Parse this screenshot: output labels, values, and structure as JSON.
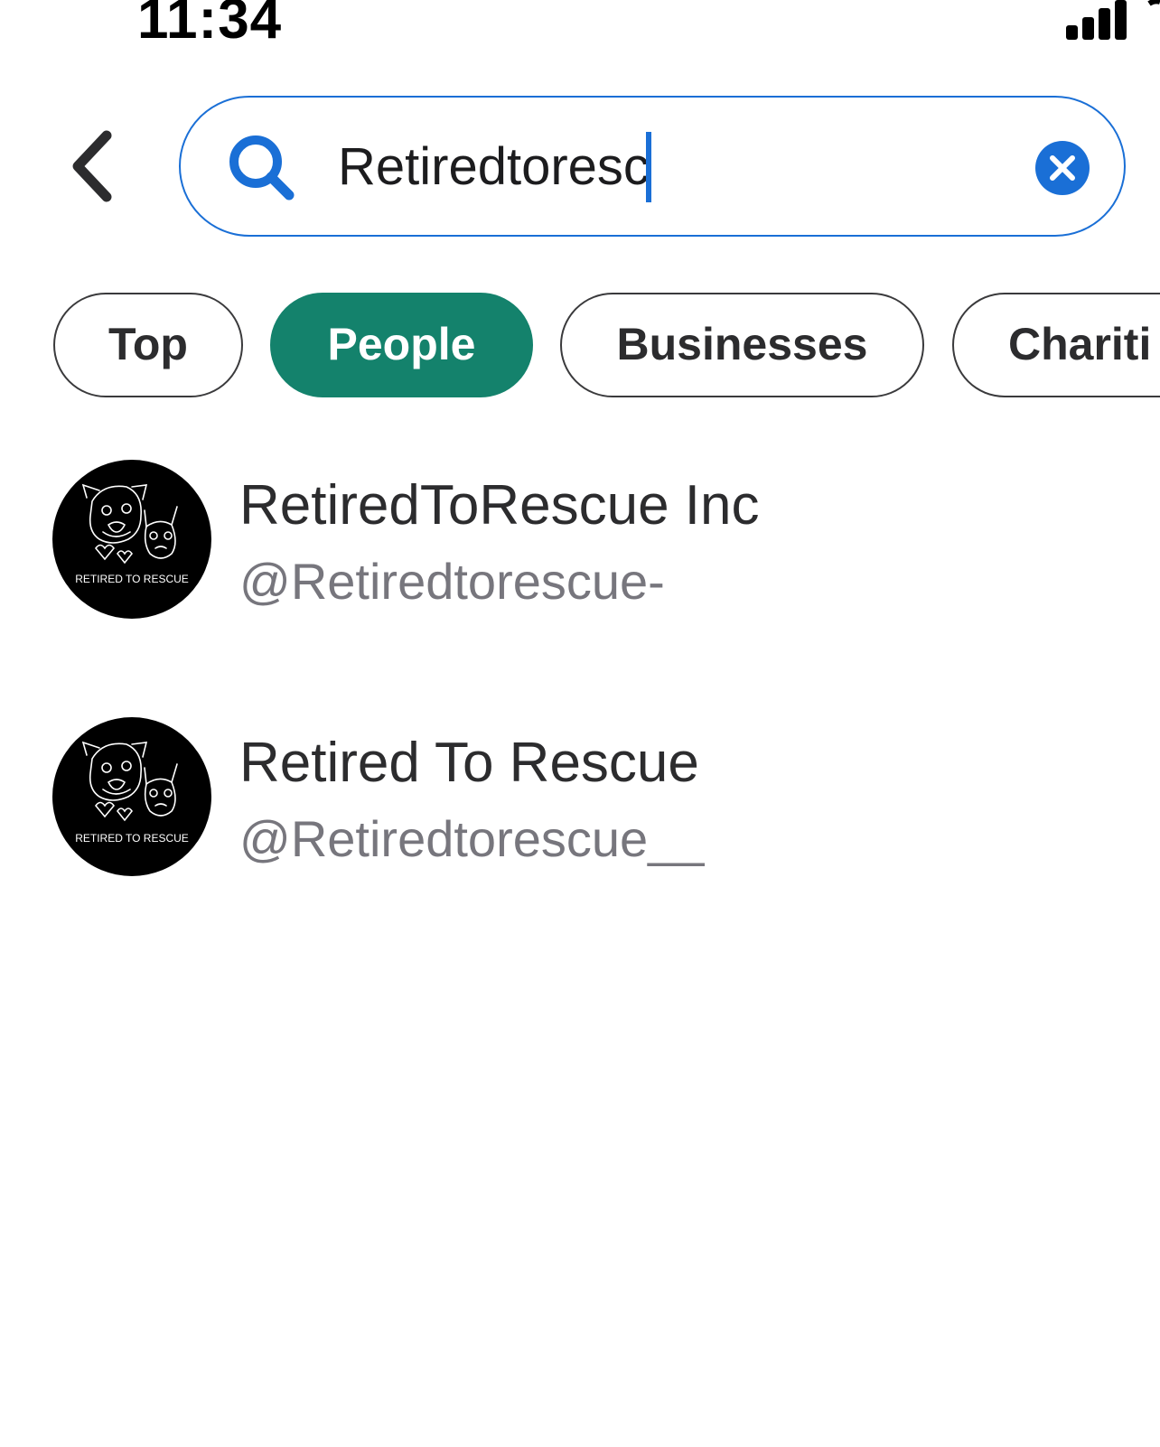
{
  "status_bar": {
    "time": "11:34"
  },
  "search": {
    "query": "Retiredtoresc"
  },
  "filters": [
    {
      "label": "Top",
      "active": false
    },
    {
      "label": "People",
      "active": true
    },
    {
      "label": "Businesses",
      "active": false
    },
    {
      "label": "Chariti",
      "active": false
    }
  ],
  "results": [
    {
      "name": "RetiredToRescue Inc",
      "handle": "@Retiredtorescue-",
      "avatar_text": "RETIRED TO RESCUE"
    },
    {
      "name": "Retired To Rescue",
      "handle": "@Retiredtorescue__",
      "avatar_text": "RETIRED TO RESCUE"
    }
  ],
  "colors": {
    "accent_blue": "#1a6fd6",
    "active_chip": "#14826c",
    "handle_gray": "#77767d"
  }
}
